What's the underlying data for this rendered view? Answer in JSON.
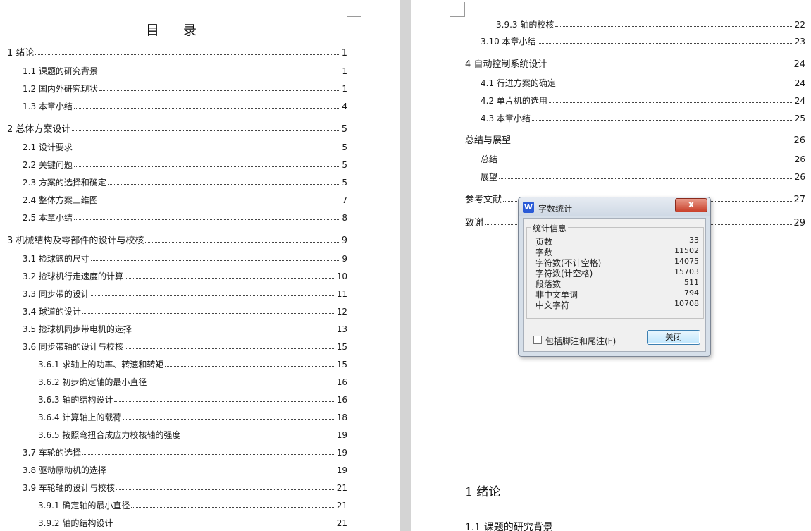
{
  "toc_title": "目  录",
  "toc_left": [
    {
      "text": "1  绪论",
      "page": "1"
    },
    {
      "text": "1.1 课题的研究背景",
      "page": "1"
    },
    {
      "text": "1.2 国内外研究现状",
      "page": "1"
    },
    {
      "text": "1.3 本章小结",
      "page": "4"
    },
    {
      "text": "2  总体方案设计",
      "page": "5"
    },
    {
      "text": "2.1 设计要求",
      "page": "5"
    },
    {
      "text": "2.2 关键问题",
      "page": "5"
    },
    {
      "text": "2.3 方案的选择和确定",
      "page": "5"
    },
    {
      "text": "2.4 整体方案三维图",
      "page": "7"
    },
    {
      "text": "2.5 本章小结",
      "page": "8"
    },
    {
      "text": "3  机械结构及零部件的设计与校核",
      "page": "9"
    },
    {
      "text": "3.1 捡球篮的尺寸",
      "page": "9"
    },
    {
      "text": "3.2 捡球机行走速度的计算",
      "page": "10"
    },
    {
      "text": "3.3 同步带的设计",
      "page": "11"
    },
    {
      "text": "3.4 球道的设计",
      "page": "12"
    },
    {
      "text": "3.5 捡球机同步带电机的选择",
      "page": "13"
    },
    {
      "text": "3.6 同步带轴的设计与校核",
      "page": "15"
    },
    {
      "text": "3.6.1 求轴上的功率、转速和转矩",
      "page": "15"
    },
    {
      "text": "3.6.2 初步确定轴的最小直径",
      "page": "16"
    },
    {
      "text": "3.6.3 轴的结构设计",
      "page": "16"
    },
    {
      "text": "3.6.4 计算轴上的载荷",
      "page": "18"
    },
    {
      "text": "3.6.5 按照弯扭合成应力校核轴的强度",
      "page": "19"
    },
    {
      "text": "3.7 车轮的选择",
      "page": "19"
    },
    {
      "text": "3.8 驱动原动机的选择",
      "page": "19"
    },
    {
      "text": "3.9 车轮轴的设计与校核",
      "page": "21"
    },
    {
      "text": "3.9.1 确定轴的最小直径",
      "page": "21"
    },
    {
      "text": "3.9.2 轴的结构设计",
      "page": "21"
    }
  ],
  "toc_right": [
    {
      "text": "3.9.3 轴的校核",
      "page": "22"
    },
    {
      "text": "3.10 本章小结",
      "page": "23"
    },
    {
      "text": "4  自动控制系统设计",
      "page": "24"
    },
    {
      "text": "4.1 行进方案的确定",
      "page": "24"
    },
    {
      "text": "4.2  单片机的选用",
      "page": "24"
    },
    {
      "text": "4.3 本章小结",
      "page": "25"
    },
    {
      "text": "总结与展望",
      "page": "26"
    },
    {
      "text": "总结",
      "page": "26"
    },
    {
      "text": "展望",
      "page": "26"
    },
    {
      "text": "参考文献",
      "page": "27"
    },
    {
      "text": "致谢",
      "page": "29"
    }
  ],
  "body_headings": {
    "chapter1": "1  绪论",
    "section1_1": "1.1 课题的研究背景"
  },
  "dialog": {
    "title": "字数统计",
    "app_icon_letter": "W",
    "close_glyph": "x",
    "group_label": "统计信息",
    "stats": [
      {
        "label": "页数",
        "value": "33"
      },
      {
        "label": "字数",
        "value": "11502"
      },
      {
        "label": "字符数(不计空格)",
        "value": "14075"
      },
      {
        "label": "字符数(计空格)",
        "value": "15703"
      },
      {
        "label": "段落数",
        "value": "511"
      },
      {
        "label": "非中文单词",
        "value": "794"
      },
      {
        "label": "中文字符",
        "value": "10708"
      }
    ],
    "checkbox_label": "包括脚注和尾注(F)",
    "checkbox_checked": false,
    "close_button_label": "关闭"
  }
}
